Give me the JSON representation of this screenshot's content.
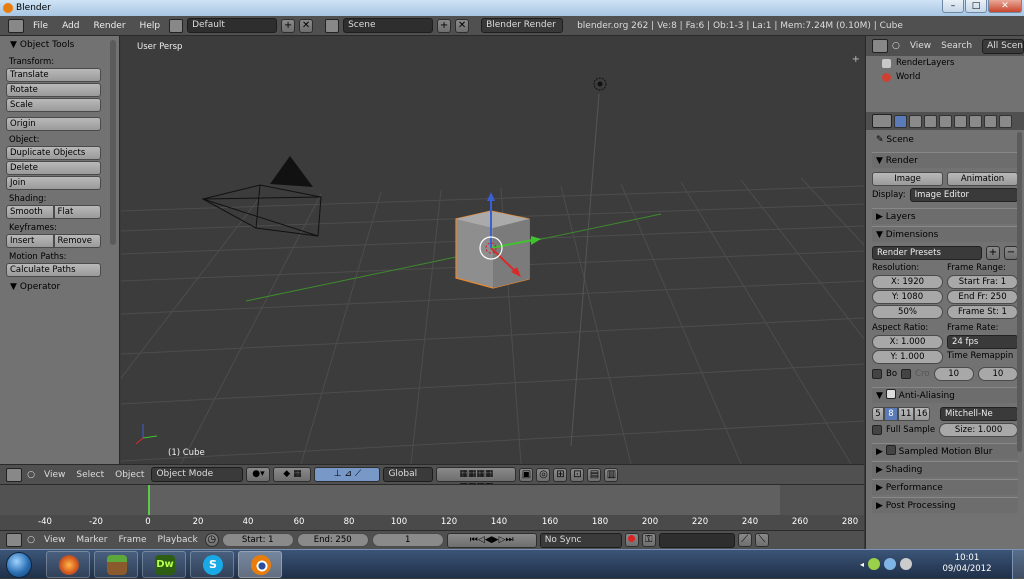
{
  "window": {
    "title": "Blender",
    "min": "–",
    "max": "□",
    "close": "✕"
  },
  "topbar": {
    "menus": [
      "File",
      "Add",
      "Render",
      "Help"
    ],
    "screen_layout": "Default",
    "scene": "Scene",
    "render_engine": "Blender Render",
    "info": "blender.org 262 | Ve:8 | Fa:6 | Ob:1-3 | La:1 | Mem:7.24M (0.10M) | Cube"
  },
  "toolshelf": {
    "title": "Object Tools",
    "transform_label": "Transform:",
    "translate": "Translate",
    "rotate": "Rotate",
    "scale": "Scale",
    "origin": "Origin",
    "object_label": "Object:",
    "duplicate": "Duplicate Objects",
    "delete": "Delete",
    "join": "Join",
    "shading_label": "Shading:",
    "smooth": "Smooth",
    "flat": "Flat",
    "keyframes_label": "Keyframes:",
    "insert": "Insert",
    "remove": "Remove",
    "motion_label": "Motion Paths:",
    "calc_paths": "Calculate Paths",
    "operator": "Operator"
  },
  "viewport": {
    "view_name": "User Persp",
    "object_info": "(1) Cube",
    "plus": "+"
  },
  "view3d_header": {
    "menus": [
      "View",
      "Select",
      "Object"
    ],
    "mode": "Object Mode",
    "orientation": "Global"
  },
  "timeline": {
    "ruler": [
      "-40",
      "-20",
      "0",
      "20",
      "40",
      "60",
      "80",
      "100",
      "120",
      "140",
      "160",
      "180",
      "200",
      "220",
      "240",
      "260",
      "280"
    ],
    "menus": [
      "View",
      "Marker",
      "Frame",
      "Playback"
    ],
    "start": "Start: 1",
    "end": "End: 250",
    "current": "1",
    "sync": "No Sync"
  },
  "outliner": {
    "menus": [
      "View",
      "Search"
    ],
    "filter": "All Scenes",
    "items": [
      {
        "label": "RenderLayers",
        "color": "#c8c8c8"
      },
      {
        "label": "World",
        "color": "#d04030"
      }
    ]
  },
  "properties": {
    "context": "Scene",
    "render": {
      "title": "Render",
      "image": "Image",
      "animation": "Animation",
      "display_label": "Display:",
      "display": "Image Editor"
    },
    "layers": "Layers",
    "dimensions": {
      "title": "Dimensions",
      "presets": "Render Presets",
      "resolution_label": "Resolution:",
      "res_x": "X: 1920",
      "res_y": "Y: 1080",
      "res_pct": "50%",
      "frame_range_label": "Frame Range:",
      "start_frame": "Start Fra: 1",
      "end_frame": "End Fr: 250",
      "frame_step": "Frame St: 1",
      "aspect_label": "Aspect Ratio:",
      "aspect_x": "X: 1.000",
      "aspect_y": "Y: 1.000",
      "framerate_label": "Frame Rate:",
      "fps": "24 fps",
      "remap_label": "Time Remappin",
      "remap_old": "10",
      "remap_new": "10",
      "border": "Bo",
      "crop": "Cro"
    },
    "antialiasing": {
      "title": "Anti-Aliasing",
      "samples": [
        "5",
        "8",
        "11",
        "16"
      ],
      "selected": "8",
      "filter": "Mitchell-Ne",
      "full_sample": "Full Sample",
      "size": "Size: 1.000"
    },
    "sampled_motion_blur": "Sampled Motion Blur",
    "shading": "Shading",
    "performance": "Performance",
    "post_processing": "Post Processing"
  },
  "taskbar": {
    "time": "10:01",
    "date": "09/04/2012"
  }
}
